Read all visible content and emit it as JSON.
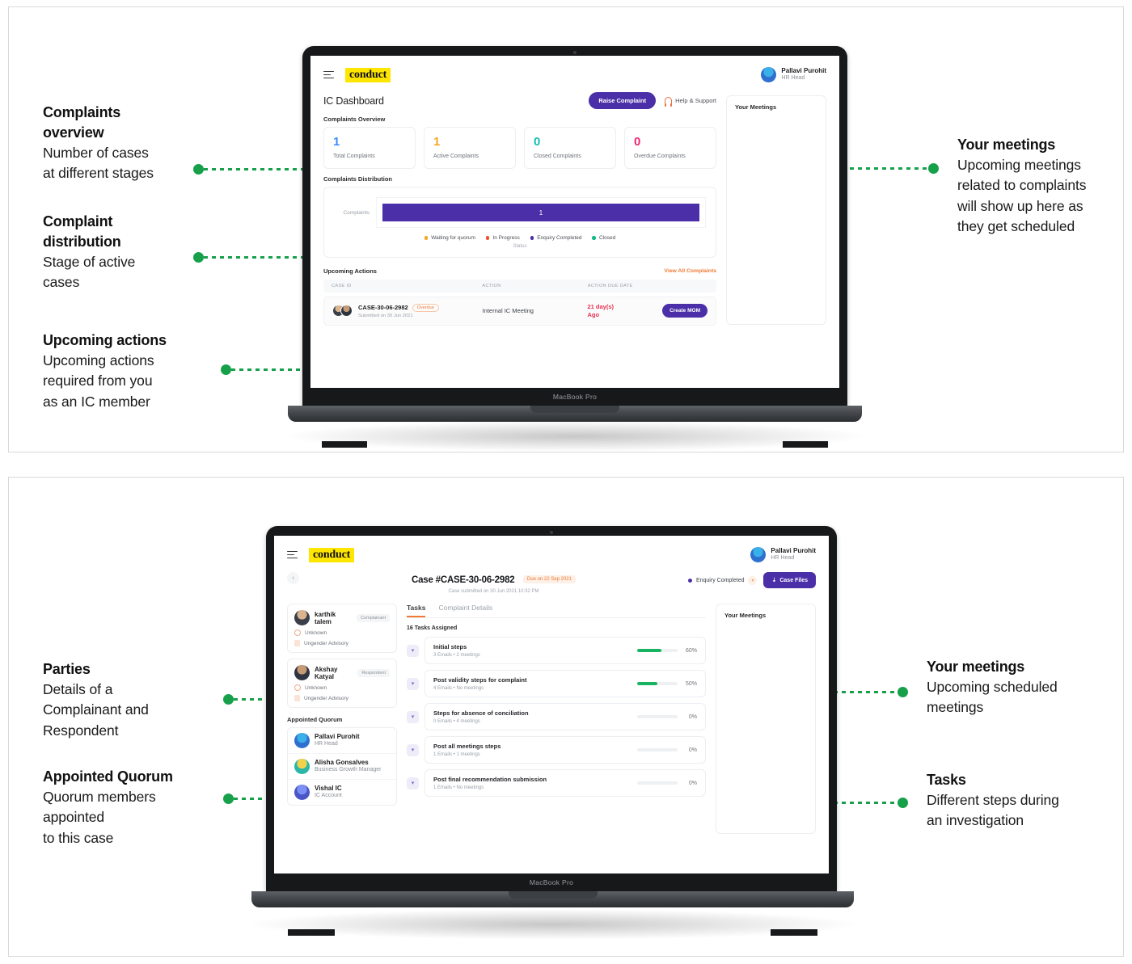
{
  "panels": [
    {
      "id": "dashboard",
      "device_label": "MacBook Pro",
      "annotations_left": [
        {
          "heading_line1": "Complaints",
          "heading_line2": "overview",
          "body_line1": "Number of cases",
          "body_line2": "at different stages"
        },
        {
          "heading_line1": "Complaint",
          "heading_line2": "distribution",
          "body_line1": "Stage of active",
          "body_line2": "cases"
        },
        {
          "heading_line1": "Upcoming actions",
          "heading_line2": "",
          "body_line1": "Upcoming actions",
          "body_line2": "required from you",
          "body_line3": "as an IC member"
        }
      ],
      "annotations_right": [
        {
          "heading_line1": "Your meetings",
          "body_line1": "Upcoming meetings",
          "body_line2": "related to complaints",
          "body_line3": "will show up here as",
          "body_line4": "they get scheduled"
        }
      ],
      "app": {
        "brand": "conduct",
        "user": {
          "name": "Pallavi Purohit",
          "role": "HR Head"
        },
        "page_title": "IC Dashboard",
        "raise_complaint_label": "Raise Complaint",
        "help_label": "Help & Support",
        "overview_label": "Complaints Overview",
        "stats": [
          {
            "value": "1",
            "caption": "Total Complaints",
            "color": "#3d8bfd"
          },
          {
            "value": "1",
            "caption": "Active Complaints",
            "color": "#f5a623"
          },
          {
            "value": "0",
            "caption": "Closed Complaints",
            "color": "#12bfb0"
          },
          {
            "value": "0",
            "caption": "Overdue Complaints",
            "color": "#f0256f"
          }
        ],
        "distribution_label": "Complaints Distribution",
        "meetings_title": "Your Meetings",
        "upcoming_label": "Upcoming Actions",
        "view_all_label": "View All Complaints",
        "table_headers": [
          "CASE ID",
          "ACTION",
          "ACTION DUE DATE"
        ],
        "row": {
          "case_id": "CASE-30-06-2982",
          "badge": "Overdue",
          "submitted": "Submitted on 30 Jun 2021",
          "action": "Internal IC Meeting",
          "due_line1": "21 day(s)",
          "due_line2": "Ago",
          "button": "Create MOM"
        }
      },
      "chart_data": {
        "type": "bar",
        "title": "Complaints Distribution",
        "orientation": "horizontal",
        "categories": [
          "Complaints"
        ],
        "values": [
          1
        ],
        "bar_labels": [
          "1"
        ],
        "xlabel": "Status",
        "ylabel": "Complaints",
        "grid": false,
        "legend_position": "bottom",
        "series": [
          {
            "name": "Waiting for quorum",
            "color": "#f5a623",
            "value": 0
          },
          {
            "name": "In Progress",
            "color": "#f0502f",
            "value": 0
          },
          {
            "name": "Enquiry Completed",
            "color": "#4b2fa8",
            "value": 1
          },
          {
            "name": "Closed",
            "color": "#12b886",
            "value": 0
          }
        ]
      }
    },
    {
      "id": "case-detail",
      "device_label": "MacBook Pro",
      "annotations_left": [
        {
          "heading_line1": "Parties",
          "body_line1": "Details of a",
          "body_line2": "Complainant and",
          "body_line3": "Respondent"
        },
        {
          "heading_line1": "Appointed Quorum",
          "body_line1": "Quorum members",
          "body_line2": "appointed",
          "body_line3": "to this case"
        }
      ],
      "annotations_right": [
        {
          "heading_line1": "Your meetings",
          "body_line1": "Upcoming scheduled",
          "body_line2": "meetings"
        },
        {
          "heading_line1": "Tasks",
          "body_line1": "Different steps during",
          "body_line2": "an investigation"
        }
      ],
      "app": {
        "brand": "conduct",
        "user": {
          "name": "Pallavi Purohit",
          "role": "HR Head"
        },
        "back_icon": "chevron-left-icon",
        "case_title": "Case #CASE-30-06-2982",
        "due_badge": "Due on 22 Sep 2021",
        "case_submitted": "Case submitted on 30 Jun 2021 10:32 PM",
        "status_label": "Enquiry Completed",
        "status_color": "#4b2fa8",
        "case_files_label": "Case Files",
        "meetings_title": "Your Meetings",
        "parties": [
          {
            "name": "karthik talem",
            "tag": "Complainant",
            "meta1": "Unknown",
            "meta2": "Ungender Advisory",
            "avatar": "person1"
          },
          {
            "name": "Akshay Katyal",
            "tag": "Respondent",
            "meta1": "Unknown",
            "meta2": "Ungender Advisory",
            "avatar": "person2"
          }
        ],
        "quorum_label": "Appointed Quorum",
        "quorum": [
          {
            "name": "Pallavi Purohit",
            "role": "HR Head",
            "avatar": "blue"
          },
          {
            "name": "Alisha Gonsalves",
            "role": "Business Growth Manager",
            "avatar": "teal"
          },
          {
            "name": "Vishal IC",
            "role": "IC Account",
            "avatar": "indigo"
          }
        ],
        "tabs": [
          {
            "label": "Tasks",
            "active": true
          },
          {
            "label": "Complaint Details",
            "active": false
          }
        ],
        "tasks_count": "16 Tasks Assigned",
        "tasks": [
          {
            "name": "Initial steps",
            "meta": "3 Emails • 2 meetings",
            "percent": 60,
            "percent_label": "60%"
          },
          {
            "name": "Post validity steps for complaint",
            "meta": "4 Emails • No meetings",
            "percent": 50,
            "percent_label": "50%"
          },
          {
            "name": "Steps for absence of conciliation",
            "meta": "0 Emails • 4 meetings",
            "percent": 0,
            "percent_label": "0%"
          },
          {
            "name": "Post all meetings steps",
            "meta": "1 Emails • 1 meetings",
            "percent": 0,
            "percent_label": "0%"
          },
          {
            "name": "Post final recommendation submission",
            "meta": "1 Emails • No meetings",
            "percent": 0,
            "percent_label": "0%"
          }
        ]
      }
    }
  ]
}
